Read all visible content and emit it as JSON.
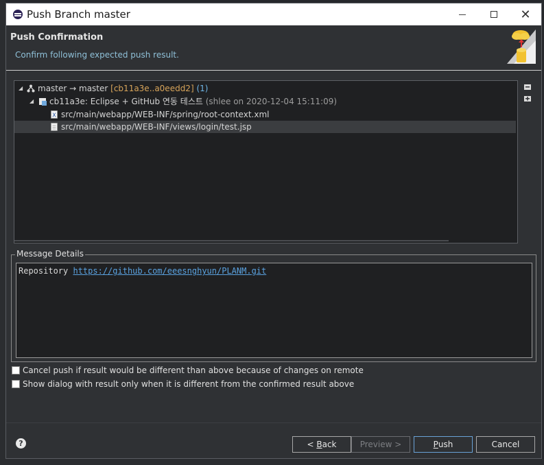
{
  "window": {
    "title": "Push Branch master",
    "minimize_icon": "minimize-icon",
    "maximize_icon": "maximize-icon",
    "close_icon": "close-icon"
  },
  "header": {
    "title": "Push Confirmation",
    "subtitle": "Confirm following expected push result."
  },
  "tree": {
    "branch": {
      "name": "master → master",
      "range": "[cb11a3e..a0eedd2]",
      "count": "(1)"
    },
    "commit": {
      "label": "cb11a3e: Eclipse + GitHub 연동 테스트",
      "meta": "(shlee on 2020-12-04 15:11:09)"
    },
    "files": [
      "src/main/webapp/WEB-INF/spring/root-context.xml",
      "src/main/webapp/WEB-INF/views/login/test.jsp"
    ]
  },
  "message": {
    "group_label": "Message Details",
    "prefix": "Repository ",
    "link": "https://github.com/eeesnghyun/PLANM.git"
  },
  "options": {
    "cancel_push": "Cancel push if result would be different than above because of changes on remote",
    "show_dialog": "Show dialog with result only when it is different from the confirmed result above"
  },
  "buttons": {
    "back_mnemonic": "B",
    "back_rest": "ack",
    "back_prefix": "< ",
    "preview": "Preview >",
    "push_mnemonic": "P",
    "push_rest": "ush",
    "cancel": "Cancel"
  },
  "help": {
    "icon": "help-icon",
    "glyph": "?"
  }
}
